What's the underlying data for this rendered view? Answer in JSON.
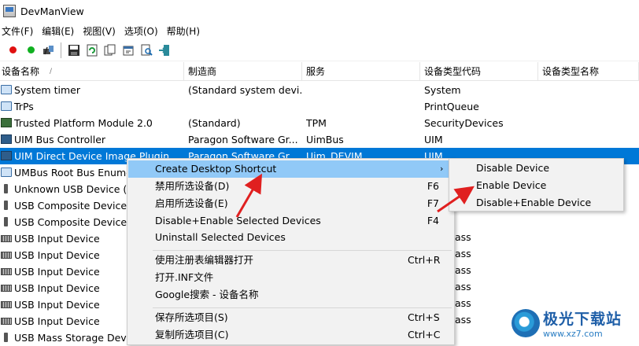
{
  "window": {
    "title": "DevManView"
  },
  "menu": [
    "文件(F)",
    "编辑(E)",
    "视图(V)",
    "选项(O)",
    "帮助(H)"
  ],
  "toolbar": {
    "buttons": [
      "disable-red-icon",
      "enable-green-icon",
      "find-device-icon",
      "save-icon",
      "refresh-icon",
      "copy-icon",
      "properties-icon",
      "search-icon",
      "exit-icon"
    ]
  },
  "columns": [
    "设备名称",
    "制造商",
    "服务",
    "设备类型代码",
    "设备类型名称"
  ],
  "rows": [
    {
      "name": "System timer",
      "manufacturer": "(Standard system devi...",
      "service": "",
      "type_code": "System",
      "icon": "monitor-icon"
    },
    {
      "name": "TrPs",
      "manufacturer": "",
      "service": "",
      "type_code": "PrintQueue",
      "icon": "monitor-icon"
    },
    {
      "name": "Trusted Platform Module 2.0",
      "manufacturer": "(Standard)",
      "service": "TPM",
      "type_code": "SecurityDevices",
      "icon": "chip-icon"
    },
    {
      "name": "UIM Bus Controller",
      "manufacturer": "Paragon Software Gr...",
      "service": "UimBus",
      "type_code": "UIM",
      "icon": "chip-icon"
    },
    {
      "name": "UIM Direct Device Image Plugin",
      "manufacturer": "Paragon Software Gr...",
      "service": "Uim_DEVIM",
      "type_code": "UIM",
      "icon": "chip-icon",
      "selected": true
    },
    {
      "name": "UMBus Root Bus Enumerator",
      "manufacturer": "",
      "service": "",
      "type_code": "",
      "icon": "monitor-icon"
    },
    {
      "name": "Unknown USB Device (Device Descriptor Request Failed)",
      "manufacturer": "",
      "service": "",
      "type_code": "",
      "icon": "usb-icon"
    },
    {
      "name": "USB Composite Device",
      "manufacturer": "",
      "service": "",
      "type_code": "",
      "icon": "usb-icon"
    },
    {
      "name": "USB Composite Device",
      "manufacturer": "",
      "service": "",
      "type_code": "",
      "icon": "usb-icon"
    },
    {
      "name": "USB Input Device",
      "manufacturer": "",
      "service": "",
      "type_code": "",
      "icon": "keyboard-icon"
    },
    {
      "name": "USB Input Device",
      "manufacturer": "",
      "service": "",
      "type_code": "",
      "icon": "keyboard-icon"
    },
    {
      "name": "USB Input Device",
      "manufacturer": "",
      "service": "",
      "type_code": "",
      "icon": "keyboard-icon"
    },
    {
      "name": "USB Input Device",
      "manufacturer": "",
      "service": "",
      "type_code": "",
      "icon": "keyboard-icon"
    },
    {
      "name": "USB Input Device",
      "manufacturer": "",
      "service": "",
      "type_code": "",
      "icon": "keyboard-icon"
    },
    {
      "name": "USB Input Device",
      "manufacturer": "",
      "service": "",
      "type_code": "",
      "icon": "keyboard-icon"
    },
    {
      "name": "USB Mass Storage Device",
      "manufacturer": "",
      "service": "",
      "type_code": "",
      "icon": "usb-icon"
    }
  ],
  "partial_text": "ass",
  "context_menu": [
    {
      "label": "Create Desktop Shortcut",
      "key": "",
      "submenu": true,
      "highlighted": true
    },
    {
      "label": "禁用所选设备(D)",
      "key": "F6"
    },
    {
      "label": "启用所选设备(E)",
      "key": "F7"
    },
    {
      "label": "Disable+Enable Selected Devices",
      "key": "F4"
    },
    {
      "label": "Uninstall Selected Devices",
      "key": ""
    },
    {
      "separator": true
    },
    {
      "label": "使用注册表编辑器打开",
      "key": "Ctrl+R"
    },
    {
      "label": "打开.INF文件",
      "key": ""
    },
    {
      "label": "Google搜索 - 设备名称",
      "key": ""
    },
    {
      "separator": true
    },
    {
      "label": "保存所选项目(S)",
      "key": "Ctrl+S"
    },
    {
      "label": "复制所选项目(C)",
      "key": "Ctrl+C"
    }
  ],
  "submenu": [
    "Disable Device",
    "Enable Device",
    "Disable+Enable Device"
  ],
  "watermark": {
    "name": "极光下载站",
    "url": "www.xz7.com"
  },
  "colors": {
    "selection": "#0078d7",
    "menu_highlight": "#91c9f7",
    "annotation_arrow": "#e02020"
  }
}
